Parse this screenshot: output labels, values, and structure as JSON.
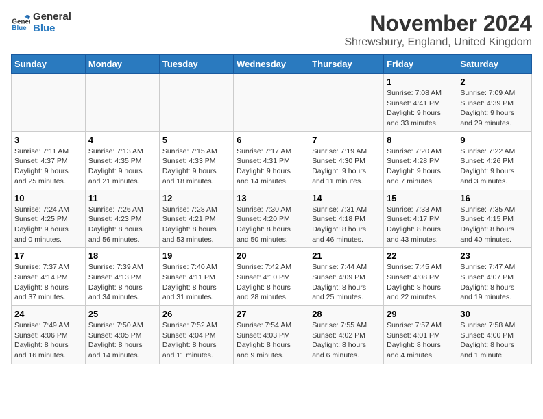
{
  "logo": {
    "line1": "General",
    "line2": "Blue"
  },
  "title": "November 2024",
  "location": "Shrewsbury, England, United Kingdom",
  "weekdays": [
    "Sunday",
    "Monday",
    "Tuesday",
    "Wednesday",
    "Thursday",
    "Friday",
    "Saturday"
  ],
  "weeks": [
    [
      {
        "day": "",
        "info": ""
      },
      {
        "day": "",
        "info": ""
      },
      {
        "day": "",
        "info": ""
      },
      {
        "day": "",
        "info": ""
      },
      {
        "day": "",
        "info": ""
      },
      {
        "day": "1",
        "info": "Sunrise: 7:08 AM\nSunset: 4:41 PM\nDaylight: 9 hours\nand 33 minutes."
      },
      {
        "day": "2",
        "info": "Sunrise: 7:09 AM\nSunset: 4:39 PM\nDaylight: 9 hours\nand 29 minutes."
      }
    ],
    [
      {
        "day": "3",
        "info": "Sunrise: 7:11 AM\nSunset: 4:37 PM\nDaylight: 9 hours\nand 25 minutes."
      },
      {
        "day": "4",
        "info": "Sunrise: 7:13 AM\nSunset: 4:35 PM\nDaylight: 9 hours\nand 21 minutes."
      },
      {
        "day": "5",
        "info": "Sunrise: 7:15 AM\nSunset: 4:33 PM\nDaylight: 9 hours\nand 18 minutes."
      },
      {
        "day": "6",
        "info": "Sunrise: 7:17 AM\nSunset: 4:31 PM\nDaylight: 9 hours\nand 14 minutes."
      },
      {
        "day": "7",
        "info": "Sunrise: 7:19 AM\nSunset: 4:30 PM\nDaylight: 9 hours\nand 11 minutes."
      },
      {
        "day": "8",
        "info": "Sunrise: 7:20 AM\nSunset: 4:28 PM\nDaylight: 9 hours\nand 7 minutes."
      },
      {
        "day": "9",
        "info": "Sunrise: 7:22 AM\nSunset: 4:26 PM\nDaylight: 9 hours\nand 3 minutes."
      }
    ],
    [
      {
        "day": "10",
        "info": "Sunrise: 7:24 AM\nSunset: 4:25 PM\nDaylight: 9 hours\nand 0 minutes."
      },
      {
        "day": "11",
        "info": "Sunrise: 7:26 AM\nSunset: 4:23 PM\nDaylight: 8 hours\nand 56 minutes."
      },
      {
        "day": "12",
        "info": "Sunrise: 7:28 AM\nSunset: 4:21 PM\nDaylight: 8 hours\nand 53 minutes."
      },
      {
        "day": "13",
        "info": "Sunrise: 7:30 AM\nSunset: 4:20 PM\nDaylight: 8 hours\nand 50 minutes."
      },
      {
        "day": "14",
        "info": "Sunrise: 7:31 AM\nSunset: 4:18 PM\nDaylight: 8 hours\nand 46 minutes."
      },
      {
        "day": "15",
        "info": "Sunrise: 7:33 AM\nSunset: 4:17 PM\nDaylight: 8 hours\nand 43 minutes."
      },
      {
        "day": "16",
        "info": "Sunrise: 7:35 AM\nSunset: 4:15 PM\nDaylight: 8 hours\nand 40 minutes."
      }
    ],
    [
      {
        "day": "17",
        "info": "Sunrise: 7:37 AM\nSunset: 4:14 PM\nDaylight: 8 hours\nand 37 minutes."
      },
      {
        "day": "18",
        "info": "Sunrise: 7:39 AM\nSunset: 4:13 PM\nDaylight: 8 hours\nand 34 minutes."
      },
      {
        "day": "19",
        "info": "Sunrise: 7:40 AM\nSunset: 4:11 PM\nDaylight: 8 hours\nand 31 minutes."
      },
      {
        "day": "20",
        "info": "Sunrise: 7:42 AM\nSunset: 4:10 PM\nDaylight: 8 hours\nand 28 minutes."
      },
      {
        "day": "21",
        "info": "Sunrise: 7:44 AM\nSunset: 4:09 PM\nDaylight: 8 hours\nand 25 minutes."
      },
      {
        "day": "22",
        "info": "Sunrise: 7:45 AM\nSunset: 4:08 PM\nDaylight: 8 hours\nand 22 minutes."
      },
      {
        "day": "23",
        "info": "Sunrise: 7:47 AM\nSunset: 4:07 PM\nDaylight: 8 hours\nand 19 minutes."
      }
    ],
    [
      {
        "day": "24",
        "info": "Sunrise: 7:49 AM\nSunset: 4:06 PM\nDaylight: 8 hours\nand 16 minutes."
      },
      {
        "day": "25",
        "info": "Sunrise: 7:50 AM\nSunset: 4:05 PM\nDaylight: 8 hours\nand 14 minutes."
      },
      {
        "day": "26",
        "info": "Sunrise: 7:52 AM\nSunset: 4:04 PM\nDaylight: 8 hours\nand 11 minutes."
      },
      {
        "day": "27",
        "info": "Sunrise: 7:54 AM\nSunset: 4:03 PM\nDaylight: 8 hours\nand 9 minutes."
      },
      {
        "day": "28",
        "info": "Sunrise: 7:55 AM\nSunset: 4:02 PM\nDaylight: 8 hours\nand 6 minutes."
      },
      {
        "day": "29",
        "info": "Sunrise: 7:57 AM\nSunset: 4:01 PM\nDaylight: 8 hours\nand 4 minutes."
      },
      {
        "day": "30",
        "info": "Sunrise: 7:58 AM\nSunset: 4:00 PM\nDaylight: 8 hours\nand 1 minute."
      }
    ]
  ]
}
